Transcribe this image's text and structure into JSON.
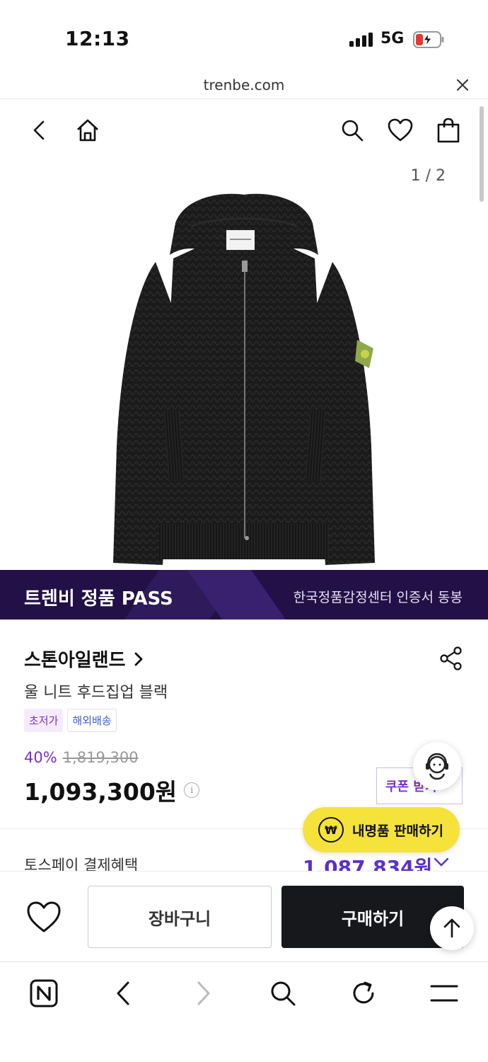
{
  "status_bar": {
    "time": "12:13",
    "network": "5G"
  },
  "browser": {
    "url": "trenbe.com"
  },
  "gallery": {
    "page_indicator": "1 / 2"
  },
  "pass_banner": {
    "title": "트렌비 정품 PASS",
    "subtitle": "한국정품감정센터 인증서 동봉"
  },
  "product": {
    "brand": "스톤아일랜드",
    "name": "울 니트 후드집업 블랙",
    "tags": [
      "초저가",
      "해외배송"
    ],
    "discount": "40%",
    "original_price": "1,819,300",
    "price": "1,093,300원"
  },
  "coupon": {
    "label": "쿠폰 받기"
  },
  "sell_button": {
    "label": "내명품 판매하기",
    "icon_text": "₩"
  },
  "toss": {
    "label": "토스페이 결제혜택",
    "price": "1,087,834원"
  },
  "actions": {
    "cart_label": "장바구니",
    "buy_label": "구매하기"
  },
  "colors": {
    "accent_purple": "#7a2fd0",
    "banner_bg": "#231046",
    "sell_button_bg": "#f5e23a",
    "buy_button_bg": "#17181c"
  }
}
